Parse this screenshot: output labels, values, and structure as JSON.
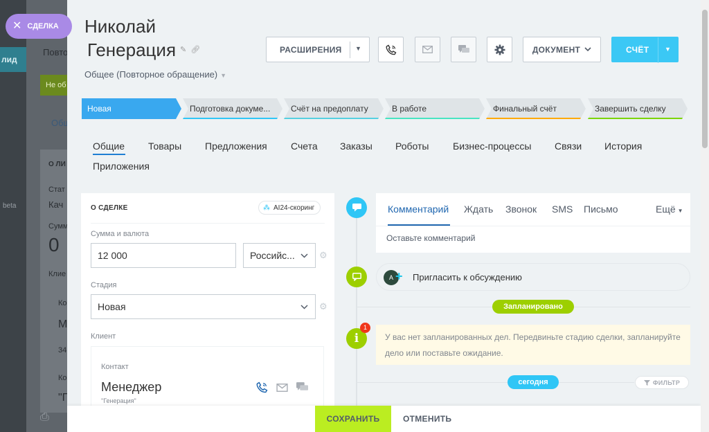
{
  "background": {
    "lid_label": "лид",
    "beta_label": "beta",
    "texts": [
      "Повто",
      "Не об",
      "Общ",
      "О ЛИ",
      "Стат",
      "Кач",
      "Сумм",
      "0",
      "Клие",
      "Ко",
      "М",
      "34",
      "Ко",
      "\"Г"
    ]
  },
  "close_tab": {
    "label": "СДЕЛКА"
  },
  "header": {
    "title_line1": "Николай",
    "title_line2": "Генерация",
    "subtitle": "Общее (Повторное обращение)"
  },
  "toolbar": {
    "extensions_label": "РАСШИРЕНИЯ",
    "document_label": "ДОКУМЕНТ",
    "invoice_label": "СЧЁТ"
  },
  "stages": [
    {
      "label": "Новая",
      "color": "#39a8ef"
    },
    {
      "label": "Подготовка докуме...",
      "color": "#2fc6f6"
    },
    {
      "label": "Счёт на предоплату",
      "color": "#55d0e0"
    },
    {
      "label": "В работе",
      "color": "#47e4c2"
    },
    {
      "label": "Финальный счёт",
      "color": "#ffa900"
    },
    {
      "label": "Завершить сделку",
      "color": "#7bd500"
    }
  ],
  "tabs": [
    "Общие",
    "Товары",
    "Предложения",
    "Счета",
    "Заказы",
    "Роботы",
    "Бизнес-процессы",
    "Связи",
    "История",
    "Приложения"
  ],
  "deal_card": {
    "heading": "О СДЕЛКЕ",
    "ai_badge": "AI24-скоринг",
    "amount_label": "Сумма и валюта",
    "amount_value": "12 000",
    "currency_value": "Российс...",
    "stage_label": "Стадия",
    "stage_value": "Новая",
    "client_label": "Клиент",
    "contact_label": "Контакт",
    "contact_name": "Менеджер",
    "contact_sub": "\"Генерация\""
  },
  "timeline": {
    "comment_tabs": [
      "Комментарий",
      "Ждать",
      "Звонок",
      "SMS",
      "Письмо"
    ],
    "more_label": "Ещё",
    "comment_placeholder": "Оставьте комментарий",
    "invite_text": "Пригласить к обсуждению",
    "invite_avatar": "A",
    "planned_label": "Запланировано",
    "notification_count": "1",
    "no_tasks_text": "У вас нет запланированных дел. Передвиньте стадию сделки, запланируйте дело или поставьте ожидание.",
    "today_label": "сегодня",
    "filter_label": "ФИЛЬТР"
  },
  "footer": {
    "save_label": "СОХРАНИТЬ",
    "cancel_label": "ОТМЕНИТЬ"
  }
}
